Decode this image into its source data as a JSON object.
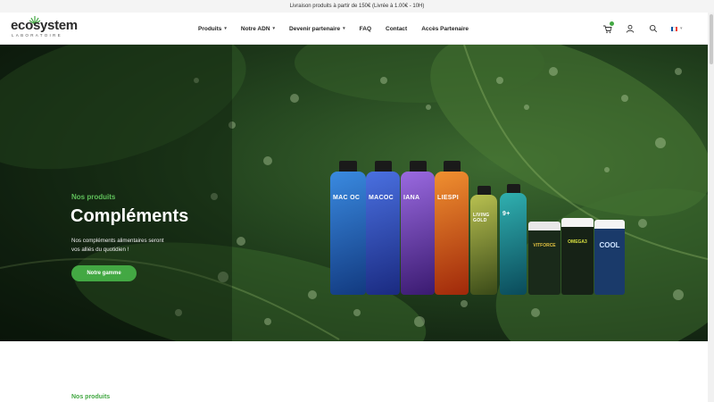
{
  "announcement": "Livraison produits à partir de 150€ (Livrée à 1.00€ - 10H)",
  "logo": {
    "name": "ecosystem",
    "tagline": "LABORATOIRE"
  },
  "nav": {
    "items": [
      {
        "label": "Produits",
        "dropdown": true
      },
      {
        "label": "Notre ADN",
        "dropdown": true
      },
      {
        "label": "Devenir partenaire",
        "dropdown": true
      },
      {
        "label": "FAQ",
        "dropdown": false
      },
      {
        "label": "Contact",
        "dropdown": false
      },
      {
        "label": "Accès Partenaire",
        "dropdown": false
      }
    ]
  },
  "header_icons": [
    "cart-icon",
    "user-icon",
    "search-icon"
  ],
  "language": {
    "code": "fr",
    "flag_colors": [
      "#0055a4",
      "#ffffff",
      "#ef4135"
    ]
  },
  "hero": {
    "label": "Nos produits",
    "title": "Compléments",
    "description": "Nos compléments alimentaires seront vos alliés du quotidien !",
    "button": "Notre gamme"
  },
  "products": [
    {
      "name": "MAC OC",
      "color": "#1e6bb8"
    },
    {
      "name": "MACOC",
      "color": "#2b4fb5"
    },
    {
      "name": "IANA",
      "color": "#6b3fa0"
    },
    {
      "name": "LIESPI",
      "color": "#d86a1a"
    },
    {
      "name": "LIVING GOLD",
      "color": "#5a8a2a"
    },
    {
      "name": "9+",
      "color": "#1a8a8a"
    },
    {
      "name": "VITFORCE",
      "color": "#6a9a2a"
    },
    {
      "name": "OMEGA3",
      "color": "#2a9a3a"
    },
    {
      "name": "COOL",
      "color": "#3a7ac8"
    }
  ],
  "section": {
    "label": "Nos produits"
  },
  "colors": {
    "accent": "#43a843"
  }
}
